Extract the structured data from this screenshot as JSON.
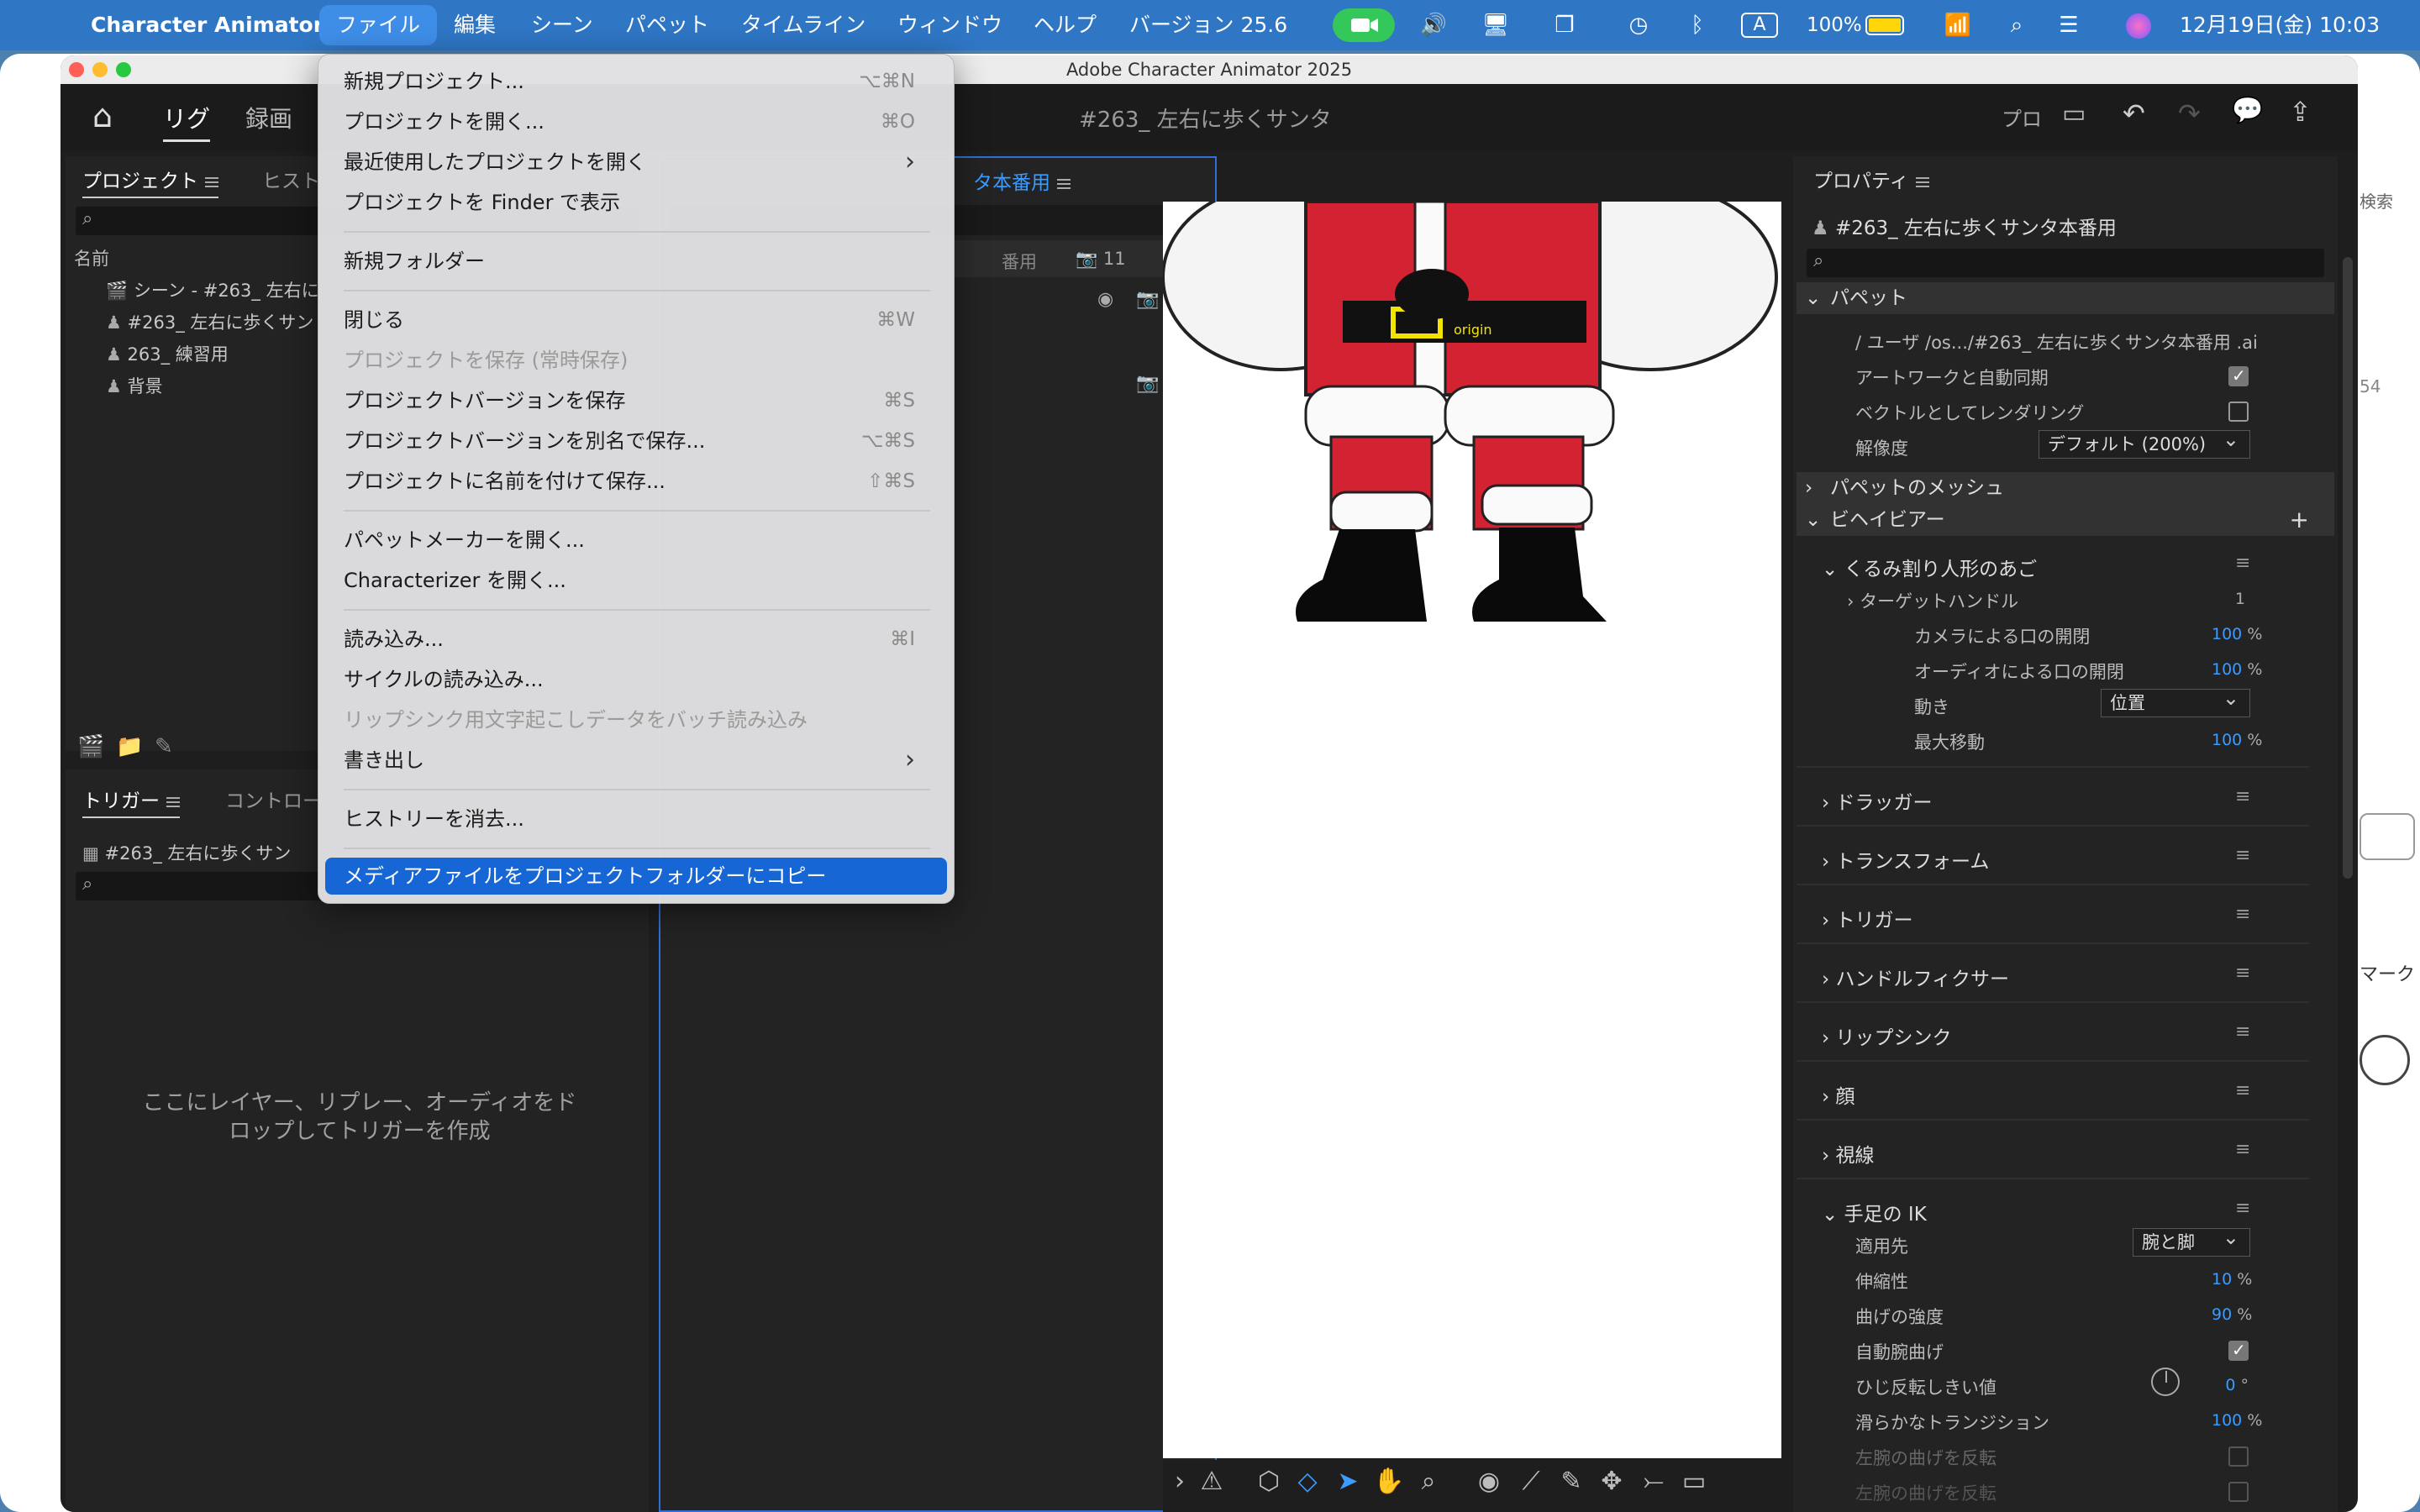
{
  "menubar": {
    "app_name": "Character Animator",
    "items": [
      "ファイル",
      "編集",
      "シーン",
      "パペット",
      "タイムライン",
      "ウィンドウ",
      "ヘルプ",
      "バージョン 25.6"
    ],
    "battery": "100%",
    "clock": "12月19日(金)  10:03",
    "input_icon_letter": "A"
  },
  "window": {
    "title": "Adobe Character Animator 2025",
    "tabs": [
      "リグ",
      "録画"
    ],
    "document_title": "#263_ 左右に歩くサンタ",
    "header_right_label": "プロ"
  },
  "project_panel": {
    "tabs": [
      "プロジェクト",
      "ヒスト"
    ],
    "column_header": "名前",
    "items": [
      "シーン - #263_ 左右に",
      "#263_ 左右に歩くサン",
      "263_ 練習用",
      "背景"
    ]
  },
  "trigger_panel": {
    "tabs": [
      "トリガー",
      "コントロー"
    ],
    "puppet": "#263_ 左右に歩くサン",
    "empty_message_line1": "ここにレイヤー、リプレー、オーディオをド",
    "empty_message_line2": "ロップしてトリガーを作成"
  },
  "puppet_panel": {
    "tab_suffix": "タ本番用",
    "row_label": "番用",
    "count": "11"
  },
  "canvas": {
    "origin_label": "origin"
  },
  "properties": {
    "title": "プロパティ",
    "puppet_name": "#263_ 左右に歩くサンタ本番用",
    "section_puppet": "パペット",
    "path": "/ ユーザ /os.../#263_ 左右に歩くサンタ本番用 .ai",
    "sync_label": "アートワークと自動同期",
    "vector_label": "ベクトルとしてレンダリング",
    "resolution_label": "解像度",
    "resolution_value": "デフォルト (200%)",
    "section_mesh": "パペットのメッシュ",
    "section_behavior": "ビヘイビアー",
    "nutcracker": {
      "title": "くるみ割り人形のあご",
      "target_handle": "ターゲットハンドル",
      "target_handle_value": "1",
      "camera": "カメラによる口の開閉",
      "camera_value": "100",
      "audio": "オーディオによる口の開閉",
      "audio_value": "100",
      "motion": "動き",
      "motion_value": "位置",
      "max_move": "最大移動",
      "max_move_value": "100"
    },
    "behaviors": [
      "ドラッガー",
      "トランスフォーム",
      "トリガー",
      "ハンドルフィクサー",
      "リップシンク",
      "顔",
      "視線"
    ],
    "ik": {
      "title": "手足の IK",
      "apply": "適用先",
      "apply_value": "腕と脚",
      "stretch": "伸縮性",
      "stretch_value": "10",
      "bend": "曲げの強度",
      "bend_value": "90",
      "auto_bend": "自動腕曲げ",
      "elbow": "ひじ反転しきい値",
      "elbow_value": "0",
      "smooth": "滑らかなトランジション",
      "smooth_value": "100",
      "left_bend": "左腕の曲げを反転",
      "left_flip": "左腕の曲げを反転"
    },
    "percent": "%",
    "degree": "°"
  },
  "file_menu": {
    "items": [
      {
        "label": "新規プロジェクト...",
        "shortcut": "⌥⌘N"
      },
      {
        "label": "プロジェクトを開く...",
        "shortcut": "⌘O"
      },
      {
        "label": "最近使用したプロジェクトを開く",
        "shortcut": "›"
      },
      {
        "label": "プロジェクトを Finder で表示",
        "shortcut": ""
      },
      {
        "label": "新規フォルダー",
        "shortcut": ""
      },
      {
        "label": "閉じる",
        "shortcut": "⌘W"
      },
      {
        "label": "プロジェクトを保存 (常時保存)",
        "shortcut": ""
      },
      {
        "label": "プロジェクトバージョンを保存",
        "shortcut": "⌘S"
      },
      {
        "label": "プロジェクトバージョンを別名で保存...",
        "shortcut": "⌥⌘S"
      },
      {
        "label": "プロジェクトに名前を付けて保存...",
        "shortcut": "⇧⌘S"
      },
      {
        "label": "パペットメーカーを開く...",
        "shortcut": ""
      },
      {
        "label": "Characterizer を開く...",
        "shortcut": ""
      },
      {
        "label": "読み込み...",
        "shortcut": "⌘I"
      },
      {
        "label": "サイクルの読み込み...",
        "shortcut": ""
      },
      {
        "label": "リップシンク用文字起こしデータをバッチ読み込み",
        "shortcut": ""
      },
      {
        "label": "書き出し",
        "shortcut": "›"
      },
      {
        "label": "ヒストリーを消去...",
        "shortcut": ""
      },
      {
        "label": "メディアファイルをプロジェクトフォルダーにコピー",
        "shortcut": ""
      }
    ]
  },
  "right_edge": {
    "search": "検索",
    "mark": "マーク",
    "num": "54"
  }
}
